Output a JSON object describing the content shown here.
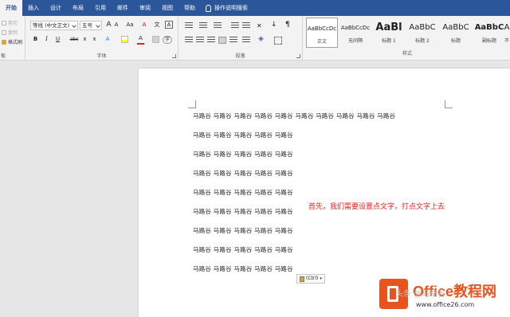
{
  "tabs": [
    "开始",
    "插入",
    "设计",
    "布局",
    "引用",
    "邮件",
    "审阅",
    "视图",
    "帮助"
  ],
  "tell_me": "操作说明搜索",
  "clipboard": {
    "cut": "剪切",
    "copy": "复制",
    "format_painter": "格式刷",
    "label": "板"
  },
  "font": {
    "name": "等线 (中文正文)",
    "size": "五号",
    "grow": "A",
    "shrink": "A",
    "case": "Aa",
    "clear": "A",
    "pinyin": "文",
    "border_char": "A",
    "bold": "B",
    "italic": "I",
    "underline": "U",
    "strike": "abc",
    "subscript": "x",
    "superscript": "x",
    "effects": "A",
    "color": "A",
    "label": "字体"
  },
  "paragraph": {
    "label": "段落"
  },
  "styles": {
    "label": "样式",
    "items": [
      {
        "sample": "AaBbCcDc",
        "name": "正文"
      },
      {
        "sample": "AaBbCcDc",
        "name": "无间隔"
      },
      {
        "sample": "AaBl",
        "name": "标题 1"
      },
      {
        "sample": "AaBbC",
        "name": "标题 2"
      },
      {
        "sample": "AaBbC",
        "name": "标题"
      },
      {
        "sample": "AaBbC",
        "name": "副标题"
      },
      {
        "sample": "A",
        "name": "不"
      }
    ]
  },
  "document": {
    "lines": [
      "马路谷 马路谷 马路谷 马路谷 马路谷 马路谷 马路谷 马路谷 马路谷 马路谷",
      "马路谷 马路谷 马路谷 马路谷 马路谷",
      "马路谷 马路谷 马路谷 马路谷 马路谷",
      "马路谷 马路谷 马路谷 马路谷 马路谷",
      "马路谷 马路谷 马路谷 马路谷 马路谷",
      "马路谷 马路谷 马路谷 马路谷 马路谷",
      "马路谷 马路谷 马路谷 马路谷 马路谷",
      "马路谷 马路谷 马路谷 马路谷 马路谷",
      "马路谷 马路谷 马路谷 马路谷 马路谷"
    ],
    "annotation": "首先，我们需要设置点文字，打点文字上去",
    "paste_options": "(Ctrl)"
  },
  "watermark": {
    "title": "Office教程网",
    "url": "www.office26.com",
    "overlay": "头条 @马路谷"
  },
  "colors": {
    "tab_bar": "#2b579a",
    "annotation": "#e8211c",
    "logo": "#e8541e"
  }
}
